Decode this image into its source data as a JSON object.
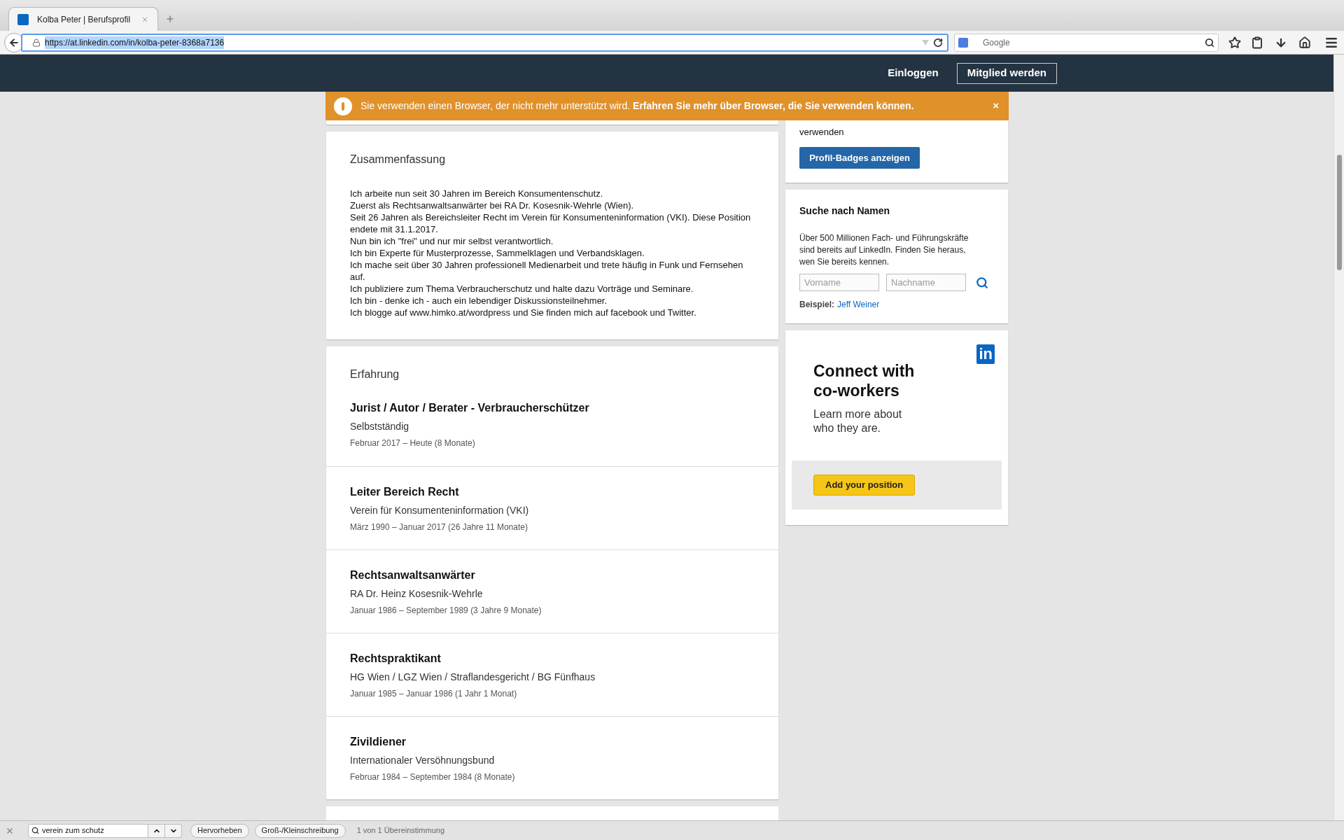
{
  "browser": {
    "tab": {
      "title": "Kolba Peter | Berufsprofil"
    },
    "url": "https://at.linkedin.com/in/kolba-peter-8368a7136",
    "search": {
      "placeholder": "Google"
    }
  },
  "header": {
    "login": "Einloggen",
    "join": "Mitglied werden"
  },
  "banner": {
    "text": "Sie verwenden einen Browser, der nicht mehr unterstützt wird. **Erfahren Sie mehr über Browser, die Sie verwenden können.**",
    "close": "×"
  },
  "summary": {
    "title": "Zusammenfassung",
    "lines": [
      "Ich arbeite nun seit 30 Jahren im Bereich Konsumentenschutz.",
      "Zuerst als Rechtsanwaltsanwärter bei RA Dr. Kosesnik-Wehrle (Wien).",
      "Seit 26 Jahren als Bereichsleiter Recht im Verein für Konsumenteninformation (VKI). Diese Position endete mit 31.1.2017.",
      "Nun bin ich \"frei\" und nur mir selbst verantwortlich.",
      "Ich bin Experte für Musterprozesse, Sammelklagen und Verbandsklagen.",
      "Ich mache seit über 30 Jahren professionell Medienarbeit und trete häufig in Funk und Fernsehen auf.",
      "Ich publiziere zum Thema Verbraucherschutz und halte dazu Vorträge und Seminare.",
      "Ich bin - denke ich - auch ein lebendiger Diskussionsteilnehmer.",
      "Ich blogge auf www.himko.at/wordpress und Sie finden mich auf facebook und Twitter."
    ]
  },
  "experience": {
    "title": "Erfahrung",
    "positions": [
      {
        "title": "Jurist / Autor / Berater - Verbraucherschützer",
        "company": "Selbstständig",
        "dates": "Februar 2017 – Heute (8 Monate)"
      },
      {
        "title": "Leiter Bereich Recht",
        "company": "Verein für Konsumenteninformation (VKI)",
        "dates": "März 1990 – Januar 2017 (26 Jahre 11 Monate)"
      },
      {
        "title": "Rechtsanwaltsanwärter",
        "company": "RA Dr. Heinz Kosesnik-Wehrle",
        "dates": "Januar 1986 – September 1989 (3 Jahre 9 Monate)"
      },
      {
        "title": "Rechtspraktikant",
        "company": "HG Wien / LGZ Wien / Straflandesgericht / BG Fünfhaus",
        "dates": "Januar 1985 – Januar 1986 (1 Jahr 1 Monat)"
      },
      {
        "title": "Zivildiener",
        "company": "Internationaler Versöhnungsbund",
        "dates": "Februar 1984 – September 1984 (8 Monate)"
      }
    ]
  },
  "badges": {
    "text": "verwenden",
    "button": "Profil-Badges anzeigen"
  },
  "name_search": {
    "title": "Suche nach Namen",
    "text": "Über 500 Millionen Fach- und Führungskräfte sind bereits auf LinkedIn. Finden Sie heraus, wen Sie bereits kennen.",
    "first_name": {
      "placeholder": "Vorname"
    },
    "last_name": {
      "placeholder": "Nachname"
    },
    "example_label": "Beispiel:",
    "example_link": "Jeff Weiner"
  },
  "ad": {
    "logo": "in",
    "title": "Connect with co-workers",
    "text": "Learn more about who they are.",
    "button": "Add your position"
  },
  "find_bar": {
    "query": "verein zum schutz",
    "highlight": "Hervorheben",
    "match_case": "Groß-/Kleinschreibung",
    "status": "1 von 1 Übereinstimmung"
  }
}
